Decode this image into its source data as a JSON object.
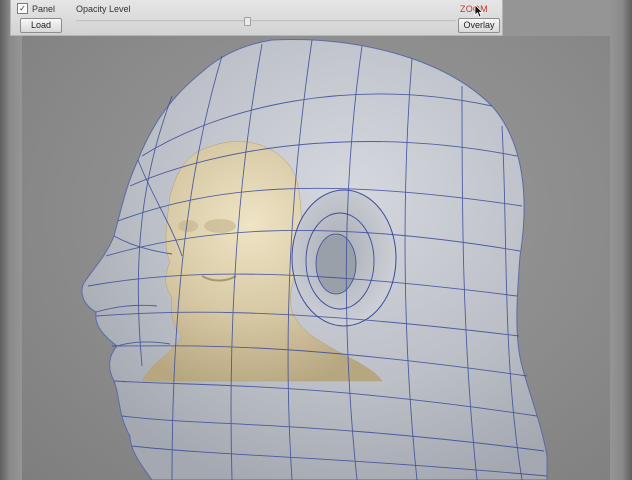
{
  "toolbar": {
    "panel_checkbox": {
      "label": "Panel",
      "checked": true,
      "mark": "✓"
    },
    "load_label": "Load",
    "opacity_label": "Opacity Level",
    "opacity_value": 0.45,
    "zoom_label": "ZOOM",
    "overlay_label": "Overlay"
  },
  "viewport": {
    "subject": "3d-head-wireframe-overlay",
    "colors": {
      "background": "#8c8c8c",
      "wireframe_head": "#c9ccd3",
      "wire_lines": "#3a4a9a",
      "sculpt": "#d9ccab"
    }
  }
}
